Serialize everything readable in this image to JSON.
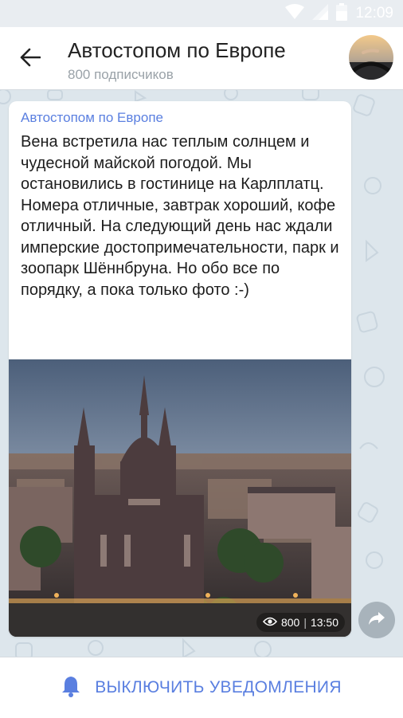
{
  "status_bar": {
    "time": "12:09"
  },
  "header": {
    "title": "Автостопом по Европе",
    "subtitle": "800 подписчиков"
  },
  "post": {
    "channel_name": "Автостопом по Европе",
    "text": "Вена встретила нас теплым солнцем и чудесной майской погодой. Мы остановились в гостинице на Карлплатц. Номера отличные, завтрак хороший, кофе отличный. На следующий день нас ждали имперские достопримечательности, парк и зоопарк Шённбруна. Но обо все по порядку, а пока только фото :-)",
    "views": "800",
    "separator": "|",
    "time": "13:50"
  },
  "bottom_bar": {
    "label": "ВЫКЛЮЧИТЬ УВЕДОМЛЕНИЯ"
  },
  "colors": {
    "accent": "#5a7fe0",
    "chat_bg": "#dde6ec"
  },
  "icons": [
    "wifi-icon",
    "signal-icon",
    "battery-icon",
    "back-arrow-icon",
    "eye-icon",
    "share-icon",
    "bell-icon"
  ]
}
